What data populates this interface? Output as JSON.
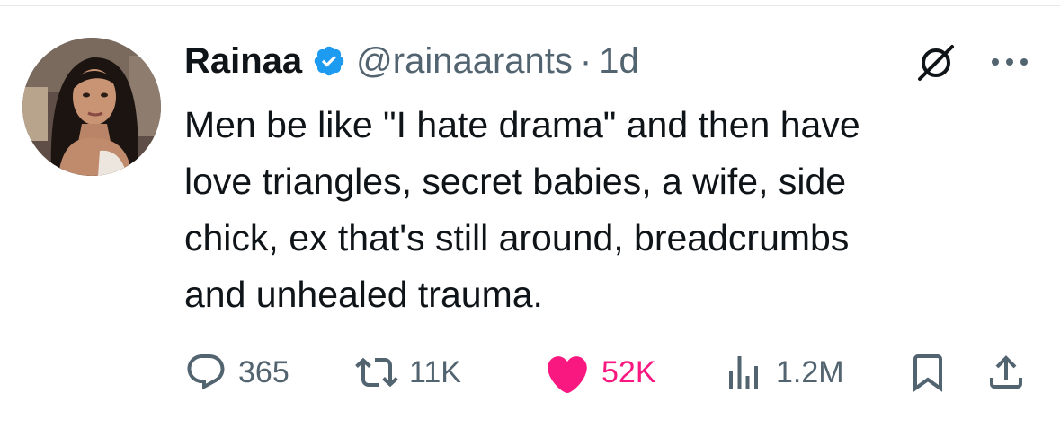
{
  "tweet": {
    "author": {
      "display_name": "Rainaa",
      "handle": "@rainaarants",
      "verified": true,
      "avatar": "profile-photo-woman-long-dark-hair"
    },
    "separator": "·",
    "time": "1d",
    "text": "Men be like \"I hate drama\" and then have\nlove triangles, secret babies, a wife, side\nchick, ex that's still around, breadcrumbs\nand unhealed trauma.",
    "actions": {
      "replies": "365",
      "reposts": "11K",
      "likes": "52K",
      "views": "1.2M"
    },
    "liked": true
  },
  "colors": {
    "text": "#0f1419",
    "secondary": "#536471",
    "verified": "#1d9bf0",
    "like": "#f91880"
  },
  "icons": {
    "verified": "verified-badge-icon",
    "grok": "grok-icon",
    "more": "more-dots-icon",
    "reply": "reply-icon",
    "repost": "repost-icon",
    "like": "heart-icon",
    "views": "views-chart-icon",
    "bookmark": "bookmark-icon",
    "share": "share-icon"
  }
}
